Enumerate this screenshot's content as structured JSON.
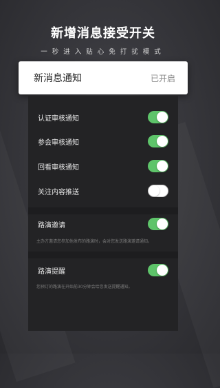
{
  "header": {
    "title": "新增消息接受开关",
    "subtitle": "一秒进入贴心免打扰模式"
  },
  "card": {
    "label": "新消息通知",
    "status": "已开启"
  },
  "settings": [
    {
      "label": "认证审核通知",
      "state": "on"
    },
    {
      "label": "参会审核通知",
      "state": "on"
    },
    {
      "label": "回看审核通知",
      "state": "on"
    },
    {
      "label": "关注内容推送",
      "state": "off"
    }
  ],
  "roadshow_invite": {
    "label": "路演邀请",
    "state": "on",
    "description": "主办方邀请您参加他发布的路演时，会对您发送路演邀请通知。"
  },
  "roadshow_reminder": {
    "label": "路演提醒",
    "state": "on",
    "description": "您预订的路演在开始前30分钟会给您发送提醒通知。"
  },
  "colors": {
    "toggle_on": "#5ec46a",
    "panel": "#232325",
    "header_card": "#ffffff"
  }
}
